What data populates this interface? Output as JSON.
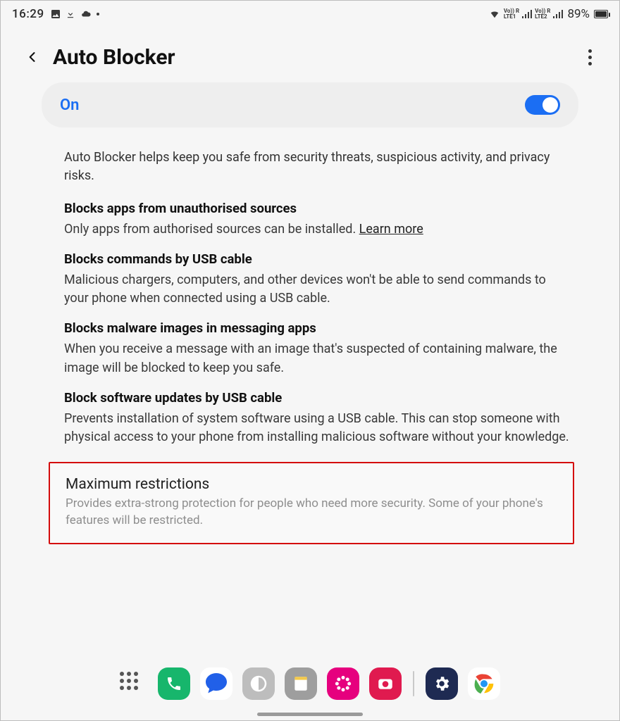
{
  "status": {
    "time": "16:29",
    "battery_pct": "89%"
  },
  "header": {
    "title": "Auto Blocker"
  },
  "toggle": {
    "state_label": "On",
    "value": true
  },
  "description": "Auto Blocker helps keep you safe from security threats, suspicious activity, and privacy risks.",
  "sections": [
    {
      "title": "Blocks apps from unauthorised sources",
      "body": "Only apps from authorised sources can be installed. ",
      "learn_more": "Learn more"
    },
    {
      "title": "Blocks commands by USB cable",
      "body": "Malicious chargers, computers, and other devices won't be able to send commands to your phone when connected using a USB cable."
    },
    {
      "title": "Blocks malware images in messaging apps",
      "body": "When you receive a message with an image that's suspected of containing malware, the image will be blocked to keep you safe."
    },
    {
      "title": "Block software updates by USB cable",
      "body": "Prevents installation of system software using a USB cable. This can stop someone with physical access to your phone from installing malicious software without your knowledge."
    }
  ],
  "max_restrictions": {
    "title": "Maximum restrictions",
    "body": "Provides extra-strong protection for people who need more security. Some of your phone's features will be restricted."
  },
  "dock": {
    "apps": [
      "phone",
      "messages",
      "bixby",
      "notes",
      "gallery",
      "camera",
      "settings",
      "chrome"
    ]
  }
}
